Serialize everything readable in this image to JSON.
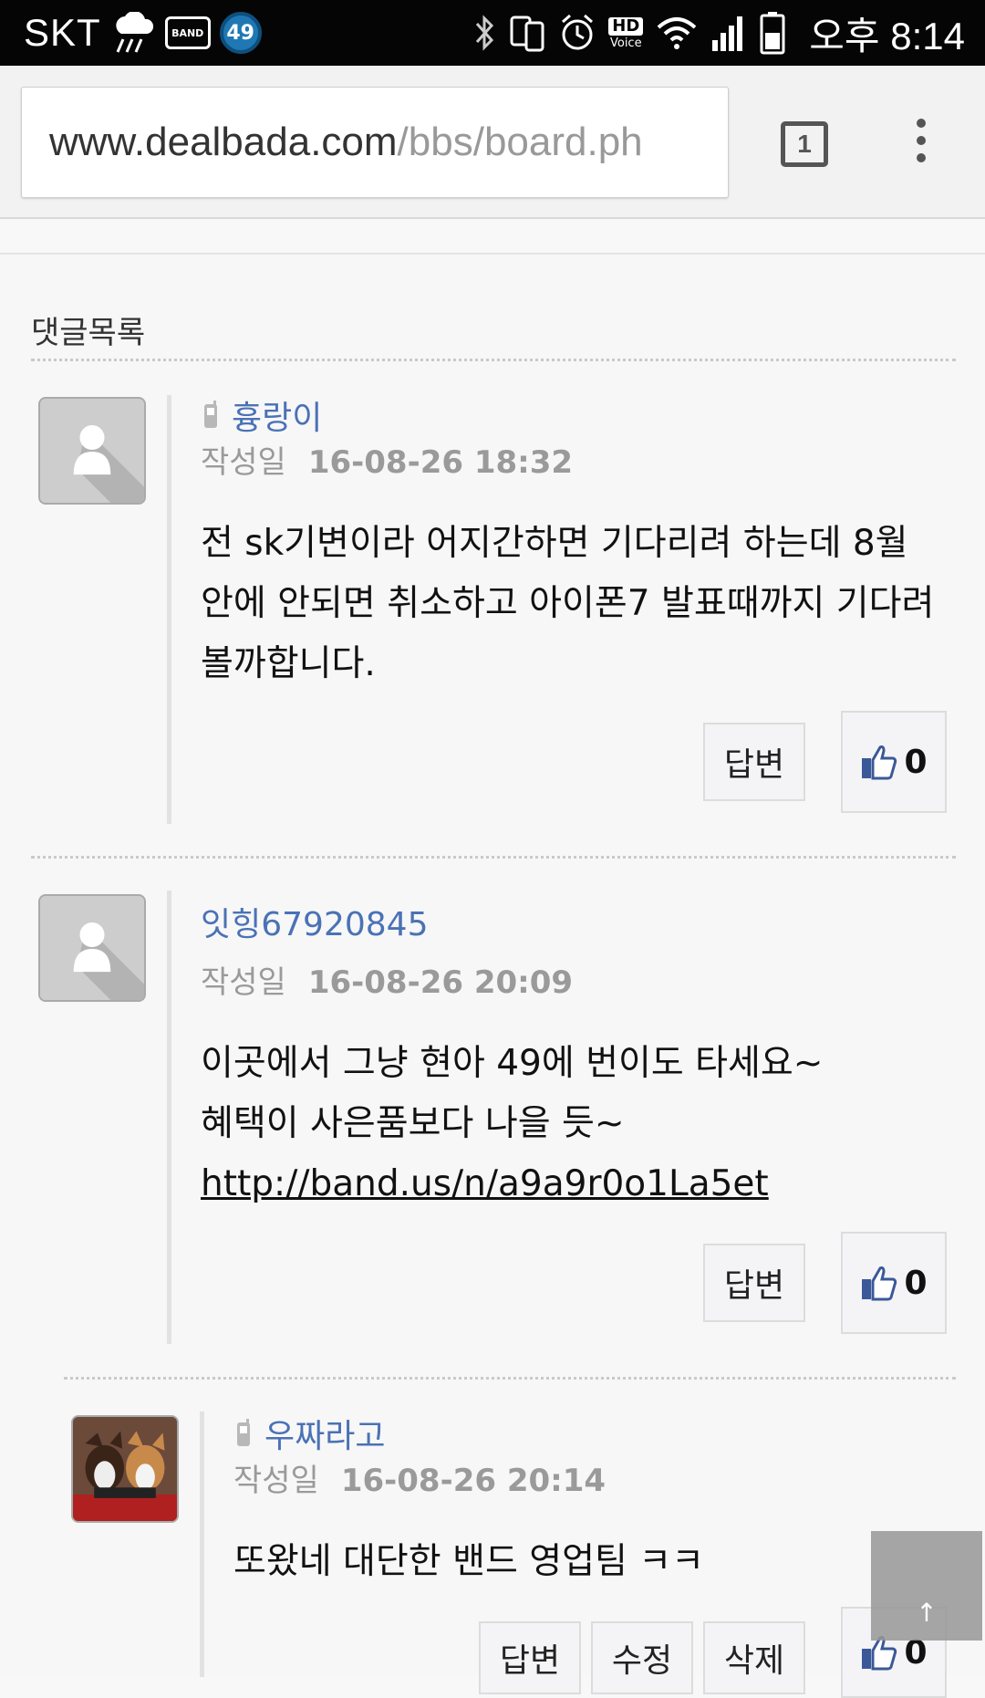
{
  "status_bar": {
    "carrier": "SKT",
    "band_label": "BAND",
    "notification_count": "49",
    "hd_label": "HD",
    "voice_label": "Voice",
    "time": "오후 8:14"
  },
  "browser": {
    "url_domain": "www.dealbada.com",
    "url_path": "/bbs/board.ph",
    "tab_count": "1"
  },
  "comments_section": {
    "title": "댓글목록",
    "date_label": "작성일",
    "reply_label": "답변",
    "edit_label": "수정",
    "delete_label": "삭제",
    "comments": [
      {
        "author": "흉랑이",
        "date": "16-08-26 18:32",
        "body": "전 sk기변이라 어지간하면 기다리려 하는데 8월 안에 안되면 취소하고 아이폰7 발표때까지 기다려 볼까합니다.",
        "likes": "0"
      },
      {
        "author": "잇힝67920845",
        "date": "16-08-26 20:09",
        "body_line1": "이곳에서 그냥 현아 49에 번이도 타세요~",
        "body_line2": "혜택이 사은품보다 나을 듯~",
        "link": "http://band.us/n/a9a9r0o1La5et",
        "likes": "0"
      },
      {
        "author": "우짜라고",
        "date": "16-08-26 20:14",
        "body": "또왔네 대단한 밴드 영업팀 ㅋㅋ",
        "likes": "0"
      }
    ]
  },
  "scroll_top_label": "↑"
}
